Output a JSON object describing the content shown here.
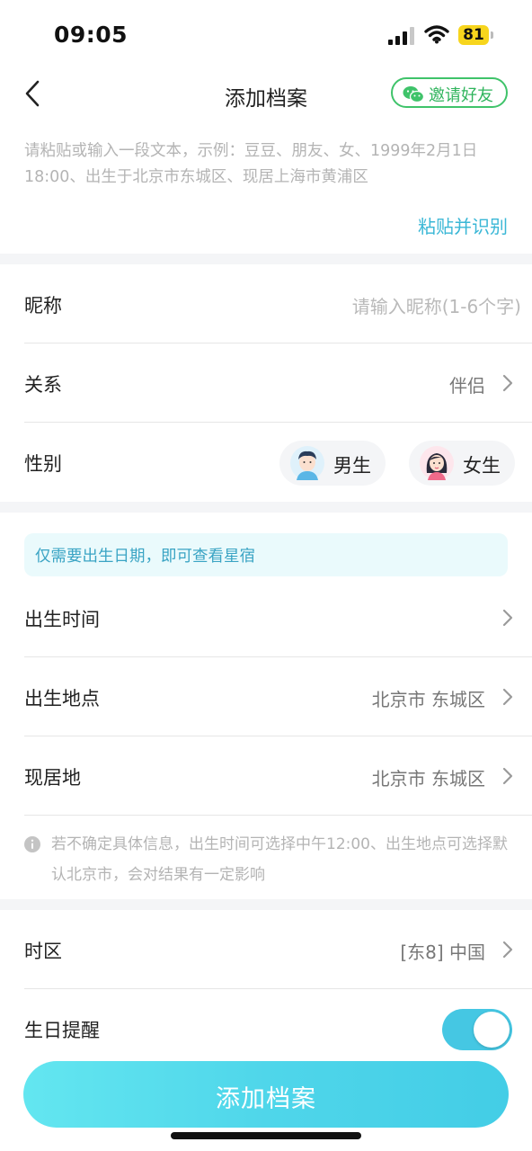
{
  "status_bar": {
    "time": "09:05",
    "battery": "81",
    "battery_color": "#f7d51d"
  },
  "nav": {
    "title": "添加档案",
    "invite_label": "邀请好友",
    "back_icon": "chevron-left-icon",
    "invite_icon": "wechat-icon"
  },
  "paste": {
    "hint": "请粘贴或输入一段文本，示例：豆豆、朋友、女、1999年2月1日18:00、出生于北京市东城区、现居上海市黄浦区",
    "button": "粘贴并识别"
  },
  "profile": {
    "nickname_label": "昵称",
    "nickname_placeholder": "请输入昵称(1-6个字)",
    "relation_label": "关系",
    "relation_value": "伴侣",
    "gender_label": "性别",
    "gender_male": "男生",
    "gender_female": "女生"
  },
  "birth": {
    "tip": "仅需要出生日期，即可查看星宿",
    "time_label": "出生时间",
    "place_label": "出生地点",
    "place_value": "北京市 东城区",
    "residence_label": "现居地",
    "residence_value": "北京市 东城区",
    "note": "若不确定具体信息，出生时间可选择中午12:00、出生地点可选择默认北京市，会对结果有一定影响"
  },
  "timezone": {
    "label": "时区",
    "value": "[东8] 中国"
  },
  "reminder": {
    "label": "生日提醒",
    "enabled": true
  },
  "submit": {
    "label": "添加档案"
  },
  "colors": {
    "accent": "#45c7e3",
    "wechat_green": "#3fc36a",
    "link": "#3ab7d6"
  }
}
